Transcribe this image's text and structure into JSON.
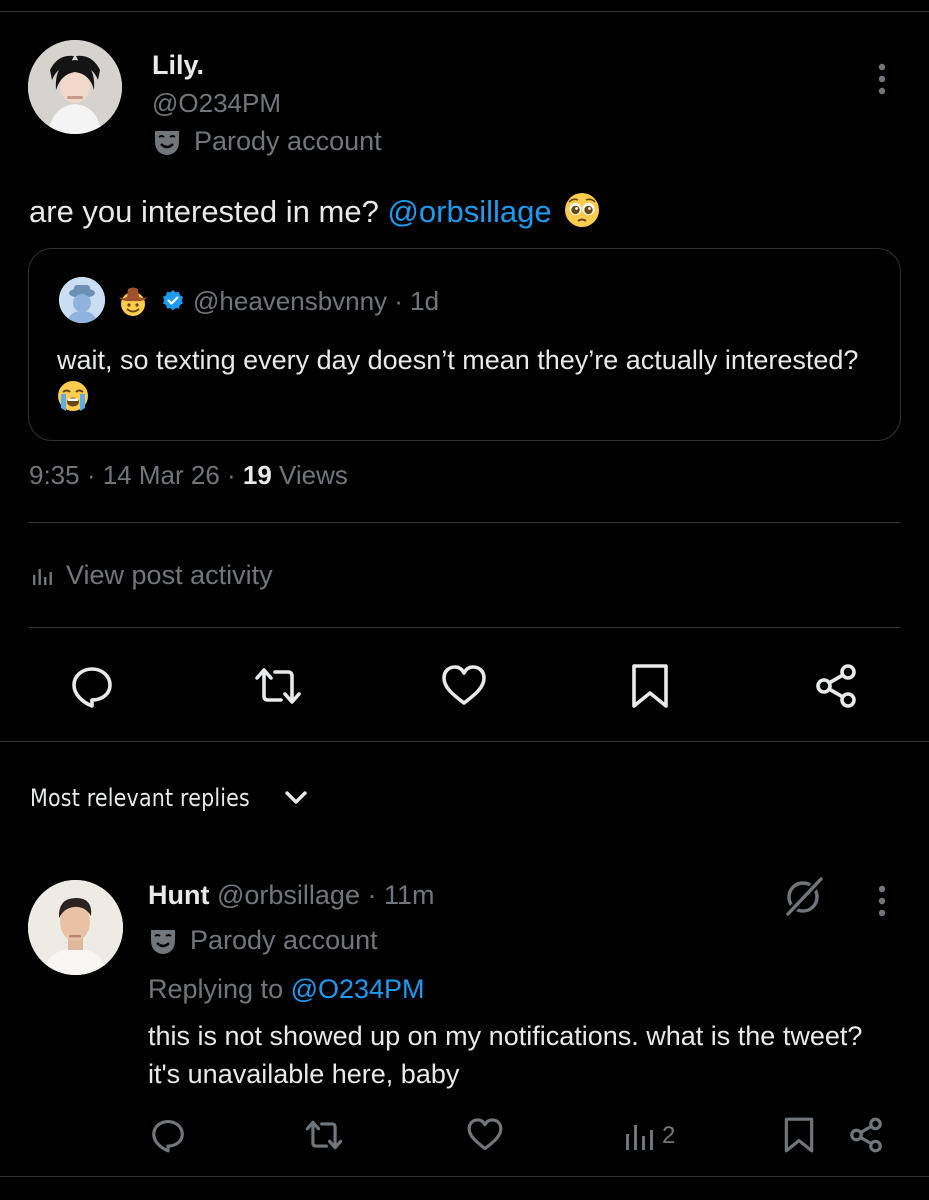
{
  "main_post": {
    "author_name": "Lily.",
    "author_handle": "@O234PM",
    "account_label": "Parody account",
    "text_prefix": "are you interested in me? ",
    "mention": "@orbsillage",
    "timestamp": "9:35 · 14 Mar 26 · ",
    "views_count": "19",
    "views_label": " Views",
    "activity_label": "View post activity"
  },
  "quoted_post": {
    "handle_and_age": "@heavensbvnny · 1d",
    "text": "wait, so texting every day doesn’t mean they’re actually interested?"
  },
  "replies_section": {
    "sort_label": "Most relevant replies"
  },
  "reply": {
    "author_name": "Hunt",
    "meta": " @orbsillage · 11m",
    "account_label": "Parody account",
    "replying_prefix": "Replying to ",
    "replying_handle": "@O234PM",
    "text": "this is not showed up on my notifications. what is the tweet? it's unavailable here, baby",
    "views_count": "2"
  },
  "colors": {
    "background": "#000000",
    "text_primary": "#e7e9ea",
    "text_secondary": "#71767b",
    "accent": "#1d9bf0",
    "border": "#2f3336"
  }
}
